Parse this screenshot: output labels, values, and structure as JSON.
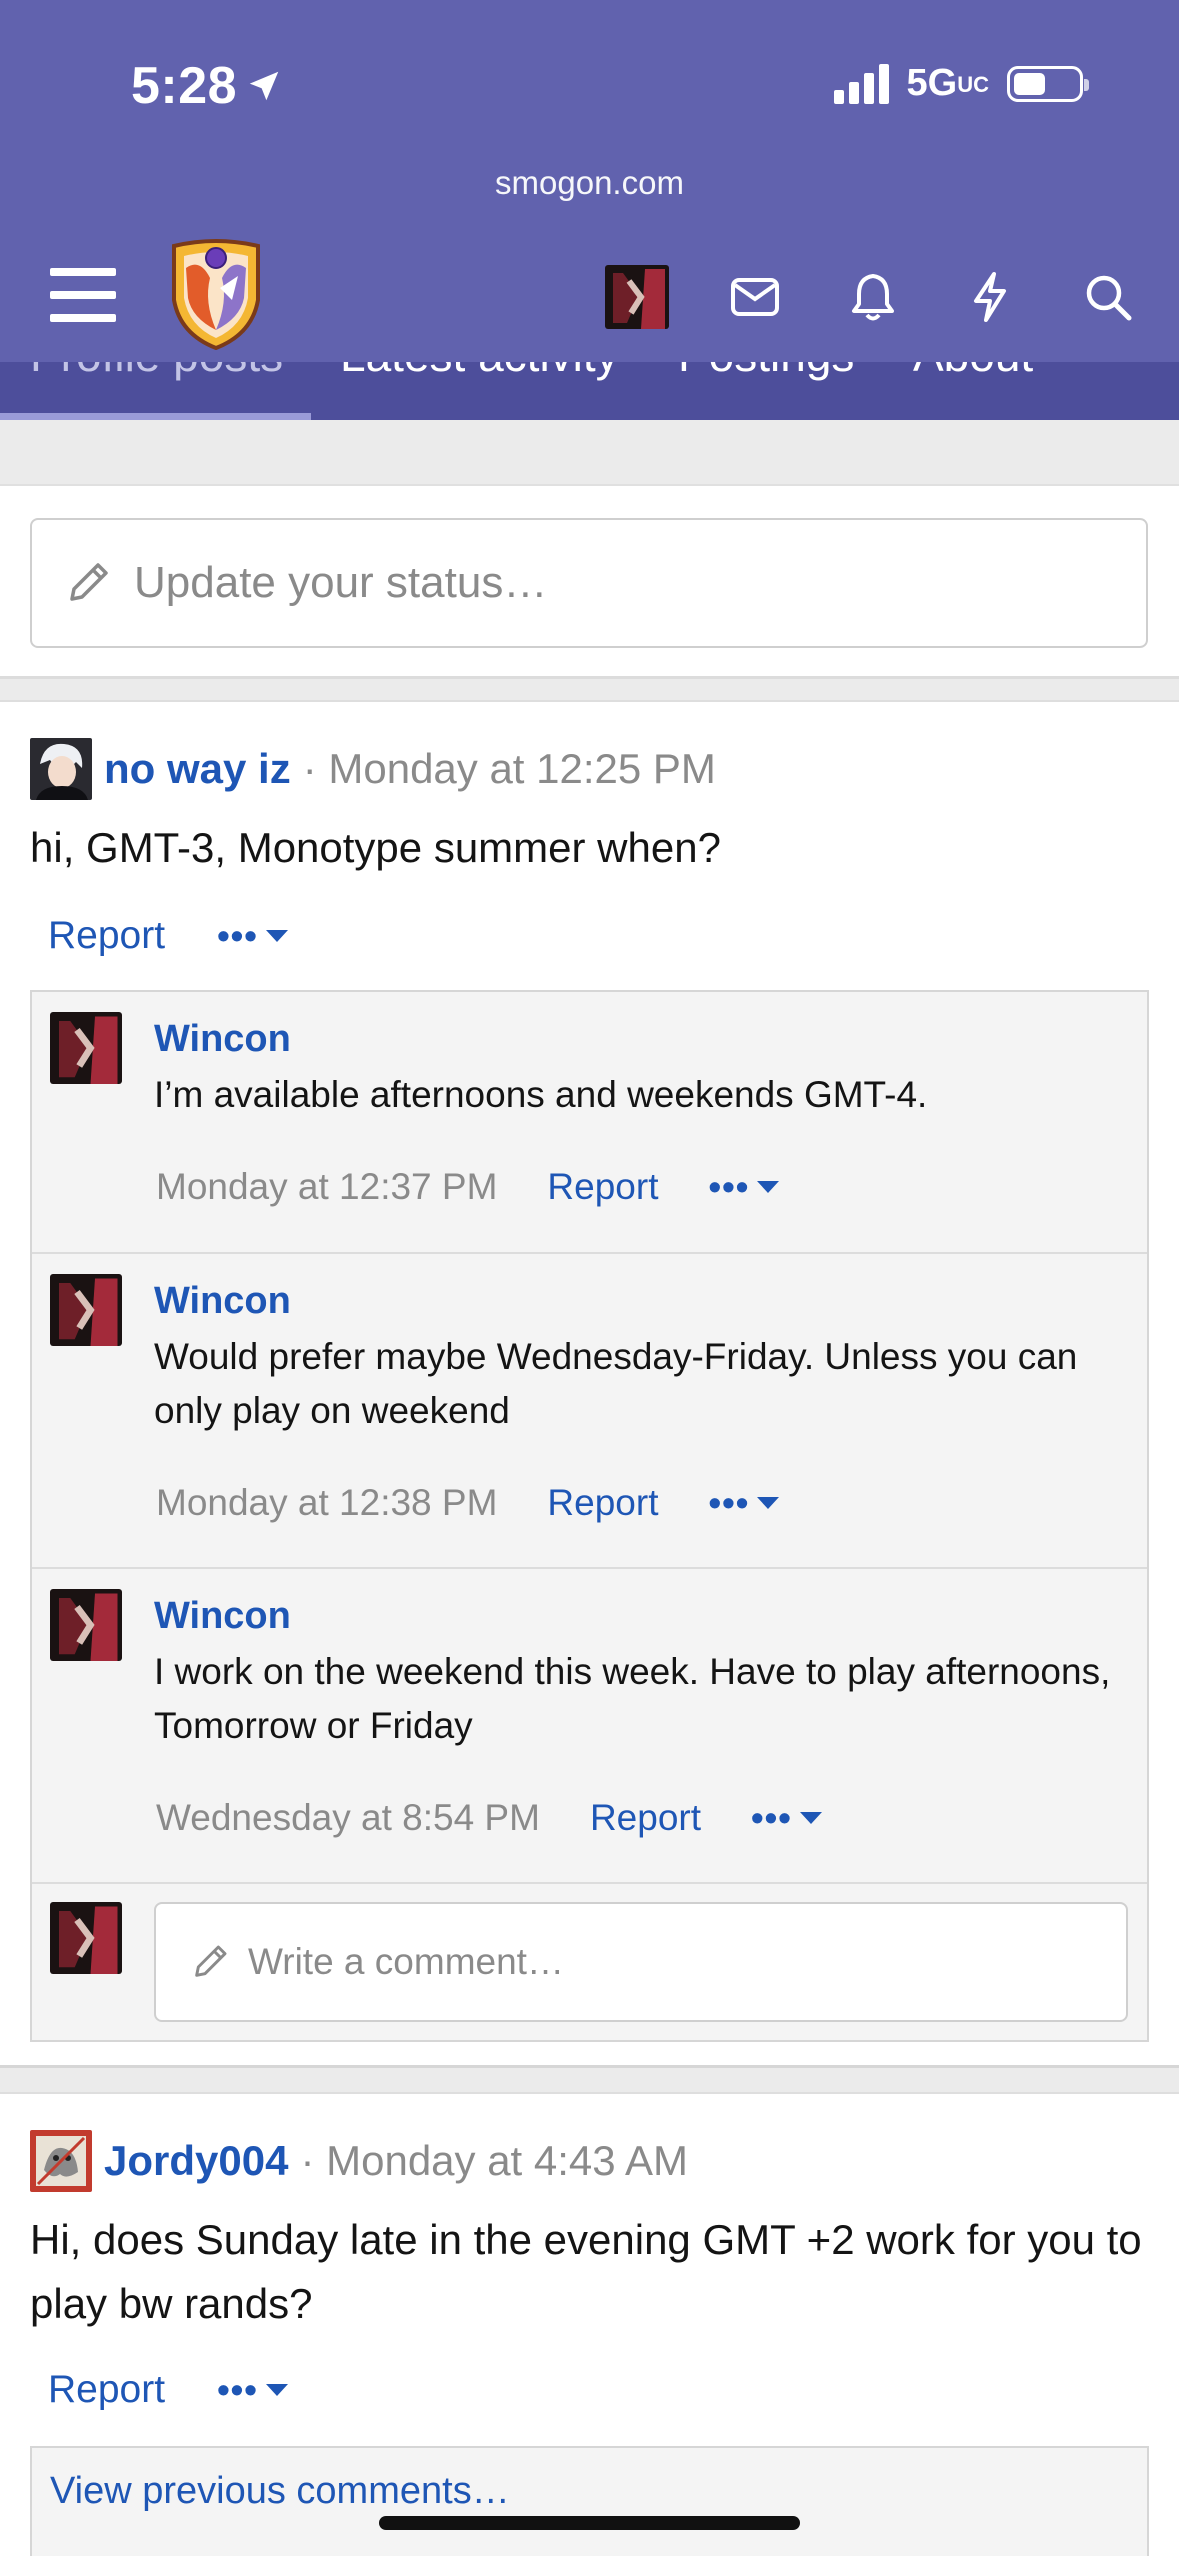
{
  "status_bar": {
    "time": "5:28",
    "network": "5G",
    "network_sub": "UC"
  },
  "browser": {
    "url": "smogon.com"
  },
  "tabs": [
    "Profile posts",
    "Latest activity",
    "Postings",
    "About"
  ],
  "status_update": {
    "placeholder": "Update your status…"
  },
  "posts": [
    {
      "user": "no way iz",
      "time": "Monday at 12:25 PM",
      "text": "hi, GMT-3, Monotype summer when?",
      "report": "Report",
      "more": "•••",
      "comments": [
        {
          "user": "Wincon",
          "text": "I’m available afternoons and weekends GMT-4.",
          "time": "Monday at 12:37 PM",
          "report": "Report",
          "more": "•••"
        },
        {
          "user": "Wincon",
          "text": "Would prefer maybe Wednesday-Friday. Unless you can only play on weekend",
          "time": "Monday at 12:38 PM",
          "report": "Report",
          "more": "•••"
        },
        {
          "user": "Wincon",
          "text": "I work on the weekend this week. Have to play afternoons, Tomorrow or Friday",
          "time": "Wednesday at 8:54 PM",
          "report": "Report",
          "more": "•••"
        }
      ],
      "comment_placeholder": "Write a comment…"
    },
    {
      "user": "Jordy004",
      "time": "Monday at 4:43 AM",
      "text": "Hi, does Sunday late in the evening GMT +2 work for you to play bw rands?",
      "report": "Report",
      "more": "•••",
      "view_previous": "View previous comments…"
    }
  ],
  "colors": {
    "header": "#6162ae",
    "tabs": "#4d4e9b",
    "link": "#1e56b5",
    "muted": "#8a8a8a"
  },
  "icons": [
    "location-arrow-icon",
    "signal-icon",
    "battery-icon",
    "menu-icon",
    "smogon-logo",
    "mail-icon",
    "bell-icon",
    "bolt-icon",
    "search-icon",
    "pencil-icon",
    "caret-down-icon"
  ]
}
